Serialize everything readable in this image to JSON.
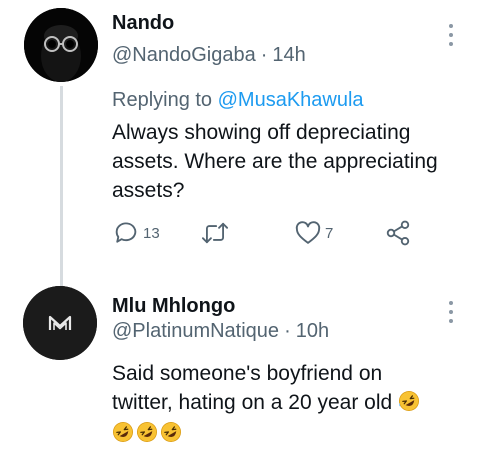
{
  "tweets": [
    {
      "name": "Nando",
      "handle": "@NandoGigaba",
      "time": "14h",
      "replying_prefix": "Replying to",
      "replying_handle": "@MusaKhawula",
      "text_lines": [
        "Always showing off depreciating",
        "assets. Where are the appreciating",
        "assets?"
      ],
      "reply_count": "13",
      "retweet_count": "",
      "like_count": "7"
    },
    {
      "name": "Mlu Mhlongo",
      "handle": "@PlatinumNatique",
      "time": "10h",
      "text_lines": [
        "Said someone's boyfriend on",
        "twitter, hating on a 20 year old"
      ],
      "emojis": [
        "rolling-on-floor-laughing",
        "rolling-on-floor-laughing",
        "rolling-on-floor-laughing",
        "rolling-on-floor-laughing"
      ]
    }
  ],
  "colors": {
    "accent": "#1d9bf0",
    "secondary_text": "#536471",
    "primary_text": "#0f1419",
    "thread_line": "#d6dbdf"
  }
}
